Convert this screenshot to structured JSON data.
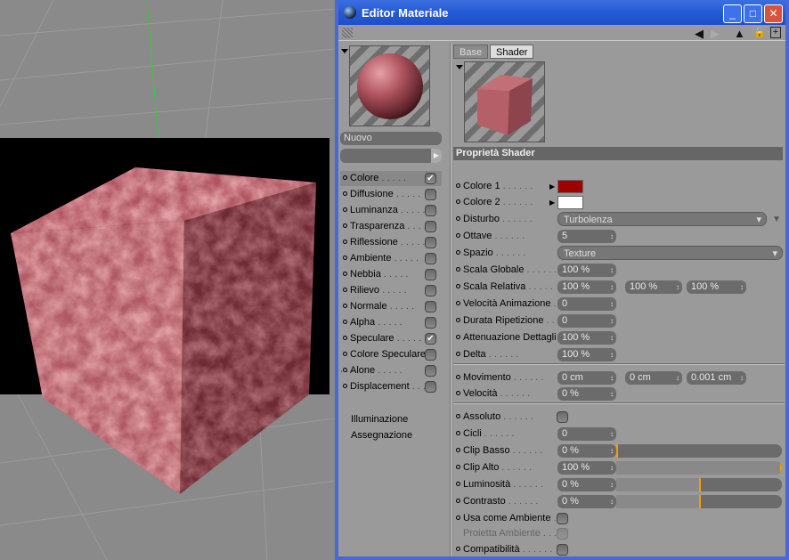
{
  "window": {
    "title": "Editor Materiale",
    "minimize": "_",
    "maximize": "□",
    "close": "✕"
  },
  "toolbar": {
    "back": "◀",
    "forward": "▶",
    "up": "▲",
    "lock": "🔓",
    "new": "+"
  },
  "material": {
    "name": "Nuovo"
  },
  "channels": [
    {
      "label": "Colore",
      "checked": true
    },
    {
      "label": "Diffusione",
      "checked": false
    },
    {
      "label": "Luminanza",
      "checked": false
    },
    {
      "label": "Trasparenza",
      "checked": false
    },
    {
      "label": "Riflessione",
      "checked": false
    },
    {
      "label": "Ambiente",
      "checked": false
    },
    {
      "label": "Nebbia",
      "checked": false
    },
    {
      "label": "Rilievo",
      "checked": false
    },
    {
      "label": "Normale",
      "checked": false
    },
    {
      "label": "Alpha",
      "checked": false
    },
    {
      "label": "Speculare",
      "checked": true
    },
    {
      "label": "Colore Speculare",
      "checked": false
    },
    {
      "label": "Alone",
      "checked": false
    },
    {
      "label": "Displacement",
      "checked": false
    }
  ],
  "extra": [
    "Illuminazione",
    "Assegnazione"
  ],
  "tabs": [
    "Base",
    "Shader"
  ],
  "section": "Proprietà Shader",
  "props": {
    "colore1": {
      "label": "Colore 1",
      "color": "#a00000"
    },
    "colore2": {
      "label": "Colore 2",
      "color": "#ffffff"
    },
    "disturbo": {
      "label": "Disturbo",
      "value": "Turbolenza"
    },
    "ottave": {
      "label": "Ottave",
      "value": "5"
    },
    "spazio": {
      "label": "Spazio",
      "value": "Texture"
    },
    "scala_globale": {
      "label": "Scala Globale",
      "value": "100 %"
    },
    "scala_relativa": {
      "label": "Scala Relativa",
      "values": [
        "100 %",
        "100 %",
        "100 %"
      ]
    },
    "velocita_anim": {
      "label": "Velocità Animazione",
      "value": "0"
    },
    "durata": {
      "label": "Durata Ripetizione",
      "value": "0"
    },
    "attenuazione": {
      "label": "Attenuazione Dettagli",
      "value": "100 %"
    },
    "delta": {
      "label": "Delta",
      "value": "100 %"
    },
    "movimento": {
      "label": "Movimento",
      "values": [
        "0 cm",
        "0 cm",
        "0.001 cm"
      ]
    },
    "velocita": {
      "label": "Velocità",
      "value": "0 %"
    },
    "assoluto": {
      "label": "Assoluto",
      "checked": false
    },
    "cicli": {
      "label": "Cicli",
      "value": "0"
    },
    "clip_basso": {
      "label": "Clip Basso",
      "value": "0 %",
      "slider": 0
    },
    "clip_alto": {
      "label": "Clip Alto",
      "value": "100 %",
      "slider": 1
    },
    "luminosita": {
      "label": "Luminosità",
      "value": "0 %",
      "slider": 0.5
    },
    "contrasto": {
      "label": "Contrasto",
      "value": "0 %",
      "slider": 0.5
    },
    "usa_ambiente": {
      "label": "Usa come Ambiente",
      "checked": false
    },
    "proietta": {
      "label": "Proietta Ambiente",
      "checked": false
    },
    "compat": {
      "label": "Compatibilità",
      "checked": false
    }
  }
}
